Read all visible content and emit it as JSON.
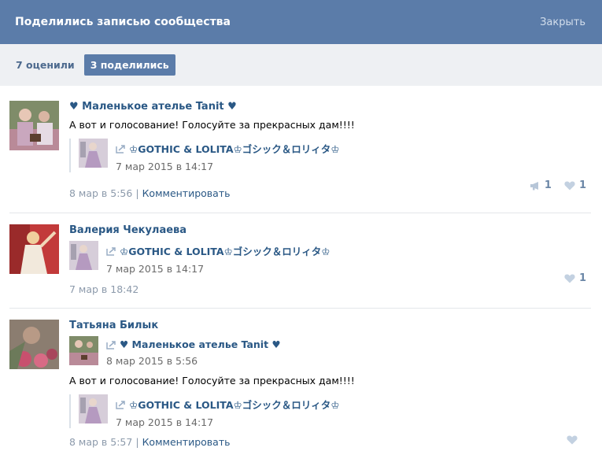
{
  "header": {
    "title": "Поделились записью сообщества",
    "close_label": "Закрыть"
  },
  "tabs": [
    {
      "label": "7 оценили",
      "active": false
    },
    {
      "label": "3 поделились",
      "active": true
    }
  ],
  "posts": [
    {
      "author": "♥ Маленькое ателье Tanit ♥",
      "text": "А вот и голосование! Голосуйте за прекрасных дам!!!!",
      "repost": {
        "name": "♔GOTHIC & LOLITA♔ゴシック＆ロリィタ♔",
        "date": "7 мар 2015 в 14:17"
      },
      "date": "8 мар в 5:56",
      "comment_label": "Комментировать",
      "reposts_count": "1",
      "likes_count": "1"
    },
    {
      "author": "Валерия Чекулаева",
      "repost": {
        "name": "♔GOTHIC & LOLITA♔ゴシック＆ロリィタ♔",
        "date": "7 мар 2015 в 14:17"
      },
      "date": "7 мар в 18:42",
      "likes_count": "1"
    },
    {
      "author": "Татьяна Билык",
      "repost": {
        "name": "♥ Маленькое ателье Tanit ♥",
        "date": "8 мар 2015 в 5:56"
      },
      "text": "А вот и голосование! Голосуйте за прекрасных дам!!!!",
      "nested_repost": {
        "name": "♔GOTHIC & LOLITA♔ゴシック＆ロリィタ♔",
        "date": "7 мар 2015 в 14:17"
      },
      "date": "8 мар в 5:57",
      "comment_label": "Комментировать"
    }
  ]
}
